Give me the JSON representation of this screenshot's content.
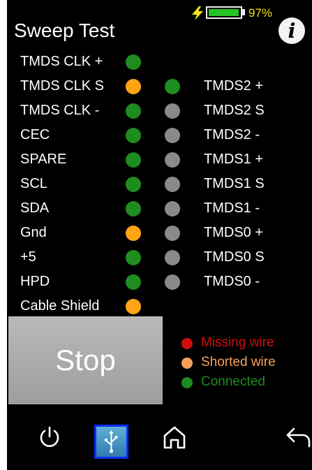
{
  "status": {
    "battery_percent": "97%",
    "battery_level": 0.97,
    "charging_icon": "lightning-bolt-icon"
  },
  "header": {
    "title": "Sweep Test",
    "info_icon": "info-icon"
  },
  "left_pins": [
    {
      "label": "TMDS CLK +",
      "status": "connected"
    },
    {
      "label": "TMDS CLK S",
      "status": "shorted"
    },
    {
      "label": "TMDS CLK -",
      "status": "connected"
    },
    {
      "label": "CEC",
      "status": "connected"
    },
    {
      "label": "SPARE",
      "status": "connected"
    },
    {
      "label": "SCL",
      "status": "connected"
    },
    {
      "label": "SDA",
      "status": "connected"
    },
    {
      "label": "Gnd",
      "status": "shorted"
    },
    {
      "label": "+5",
      "status": "connected"
    },
    {
      "label": "HPD",
      "status": "connected"
    },
    {
      "label": "Cable Shield",
      "status": "shorted"
    }
  ],
  "right_pins": [
    {
      "label": "TMDS2 +",
      "status": "connected"
    },
    {
      "label": "TMDS2 S",
      "status": "untested"
    },
    {
      "label": "TMDS2 -",
      "status": "untested"
    },
    {
      "label": "TMDS1 +",
      "status": "untested"
    },
    {
      "label": "TMDS1 S",
      "status": "untested"
    },
    {
      "label": "TMDS1 -",
      "status": "untested"
    },
    {
      "label": "TMDS0 +",
      "status": "untested"
    },
    {
      "label": "TMDS0 S",
      "status": "untested"
    },
    {
      "label": "TMDS0 -",
      "status": "untested"
    }
  ],
  "stop_button": {
    "label": "Stop"
  },
  "legend": {
    "missing": {
      "label": "Missing wire",
      "color": "#d01010"
    },
    "shorted": {
      "label": "Shorted wire",
      "color": "#f5a05a"
    },
    "connected": {
      "label": "Connected",
      "color": "#1e8c1e"
    }
  },
  "nav": {
    "power_icon": "power-icon",
    "usb_icon": "usb-icon",
    "home_icon": "home-icon",
    "back_icon": "back-arrow-icon"
  }
}
